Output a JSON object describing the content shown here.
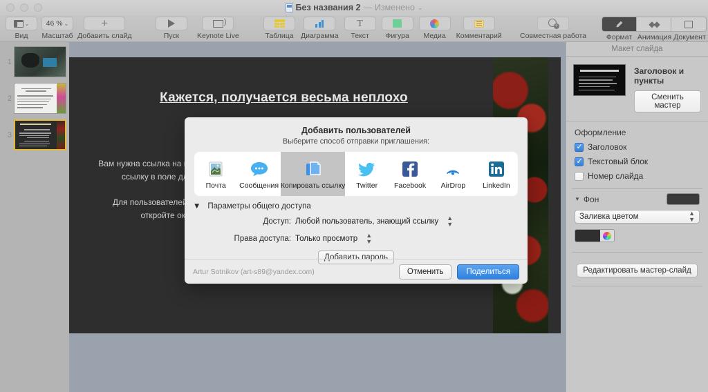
{
  "window": {
    "title": "Без названия 2",
    "separator": "—",
    "modified": "Изменено",
    "chevron": "⌄"
  },
  "toolbar": {
    "left": [
      {
        "name": "view",
        "label": "Вид",
        "icon": "view-icon",
        "chevron": "⌄"
      },
      {
        "name": "zoom",
        "label": "Масштаб",
        "value": "46 %",
        "icon": "zoom-value",
        "chevron": "⌄"
      },
      {
        "name": "add-slide",
        "label": "Добавить слайд",
        "icon": "plus-icon"
      }
    ],
    "play": [
      {
        "name": "play",
        "label": "Пуск",
        "icon": "play-icon"
      },
      {
        "name": "keynote-live",
        "label": "Keynote Live",
        "icon": "display-icon"
      }
    ],
    "insert": [
      {
        "name": "table",
        "label": "Таблица",
        "icon": "table-icon"
      },
      {
        "name": "chart",
        "label": "Диаграмма",
        "icon": "chart-icon"
      },
      {
        "name": "text",
        "label": "Текст",
        "icon": "text-icon"
      },
      {
        "name": "shape",
        "label": "Фигура",
        "icon": "shape-icon"
      },
      {
        "name": "media",
        "label": "Медиа",
        "icon": "media-icon"
      },
      {
        "name": "comment",
        "label": "Комментарий",
        "icon": "comment-icon"
      }
    ],
    "collaborate": {
      "label": "Совместная работа",
      "icon": "collaborate-icon"
    },
    "inspector_tabs": [
      {
        "label": "Формат",
        "icon": "format-icon",
        "active": true
      },
      {
        "label": "Анимация",
        "icon": "animate-icon",
        "active": false
      },
      {
        "label": "Документ",
        "icon": "document-icon",
        "active": false
      }
    ]
  },
  "navigator": {
    "slides": [
      {
        "number": "1"
      },
      {
        "number": "2"
      },
      {
        "number": "3"
      }
    ]
  },
  "slide": {
    "title": "Кажется, получается весьма неплохо",
    "paragraphs": [
      "Вам нужна ссылка на презентацию, куда автоматически добавляются все изменения? Вставьте эту ссылку в поле для встраивания на сайт. Перед этим не забудьте нажать «Поделиться».",
      "Для пользователей Keynote есть возможность пользоваться функцией встраивания. Просто откройте окно редактора публикации и презентация автоматически появится."
    ]
  },
  "inspector": {
    "panel_title": "Макет слайда",
    "layout_name": "Заголовок и пункты",
    "change_master_button": "Сменить мастер",
    "appearance_header": "Оформление",
    "checkboxes": [
      {
        "label": "Заголовок",
        "checked": true
      },
      {
        "label": "Текстовый блок",
        "checked": true
      },
      {
        "label": "Номер слайда",
        "checked": false
      }
    ],
    "background": {
      "label": "Фон",
      "disclosure": "▼",
      "fill_type": "Заливка цветом",
      "color": "#3a3a3a"
    },
    "edit_master_button": "Редактировать мастер-слайд",
    "layout_thumb_title": "Lorem Ipsum Dolor"
  },
  "dialog": {
    "title": "Добавить пользователей",
    "subtitle": "Выберите способ отправки приглашения:",
    "share_methods": [
      {
        "label": "Почта",
        "icon": "mail-icon",
        "selected": false
      },
      {
        "label": "Сообщения",
        "icon": "messages-icon",
        "selected": false
      },
      {
        "label": "Копировать ссылку",
        "icon": "copy-link-icon",
        "selected": true
      },
      {
        "label": "Twitter",
        "icon": "twitter-icon",
        "selected": false
      },
      {
        "label": "Facebook",
        "icon": "facebook-icon",
        "selected": false
      },
      {
        "label": "AirDrop",
        "icon": "airdrop-icon",
        "selected": false
      },
      {
        "label": "LinkedIn",
        "icon": "linkedin-icon",
        "selected": false
      }
    ],
    "options_header": "Параметры общего доступа",
    "options_disclosure": "▼",
    "access_label": "Доступ:",
    "access_value": "Любой пользователь, знающий ссылку",
    "permission_label": "Права доступа:",
    "permission_value": "Только просмотр",
    "add_password_button": "Добавить пароль",
    "account": "Artur Sotnikov (art-s89@yandex.com)",
    "cancel_button": "Отменить",
    "share_button": "Поделиться",
    "accent_color": "#2f82e0"
  }
}
